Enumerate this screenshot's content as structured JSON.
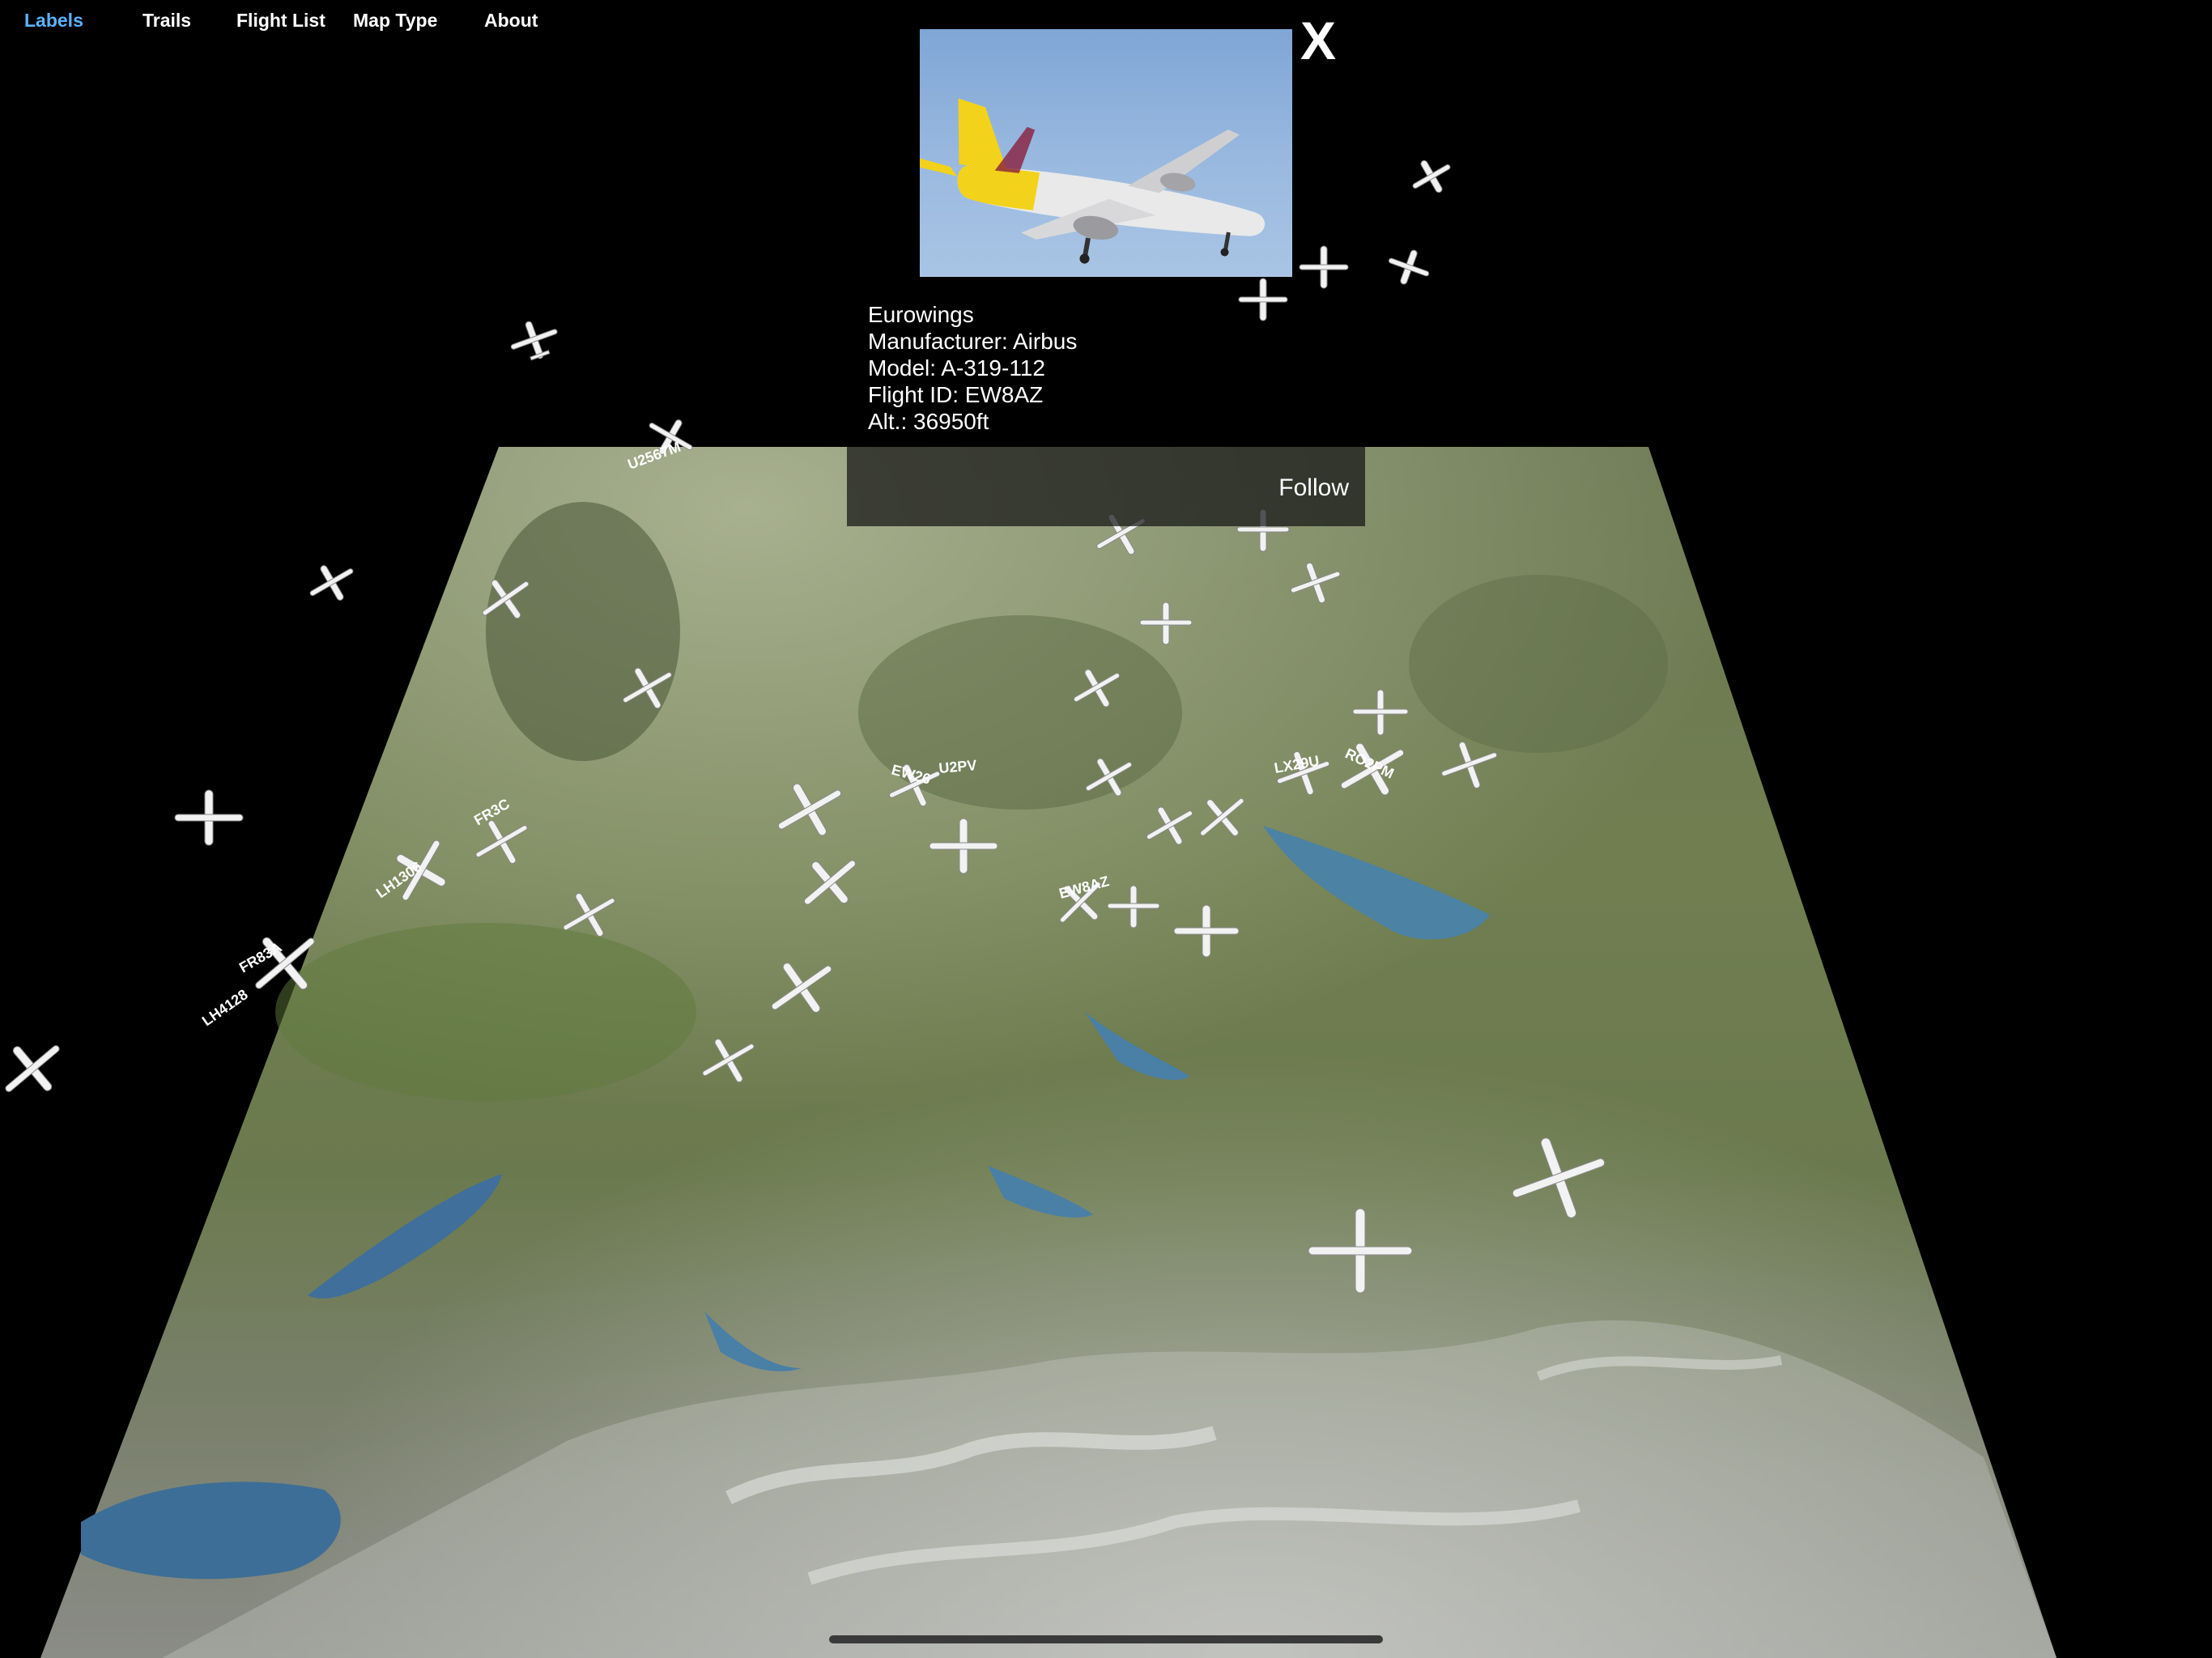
{
  "nav": {
    "labels": "Labels",
    "trails": "Trails",
    "flight_list": "Flight List",
    "map_type": "Map Type",
    "about": "About"
  },
  "close_label": "X",
  "flight_info": {
    "airline": "Eurowings",
    "manufacturer": "Manufacturer: Airbus",
    "model": "Model: A-319-112",
    "flight_id": "Flight ID: EW8AZ",
    "altitude": "Alt.: 36950ft"
  },
  "follow_label": "Follow",
  "aircraft_labels": [
    "U2567M",
    "LH1306",
    "FR3C",
    "LH4128",
    "FR83A",
    "RO2PM",
    "EW26",
    "LX29U",
    "EW8AZ",
    "U2PV"
  ],
  "colors": {
    "accent": "#5ab3ff",
    "background": "#000000"
  }
}
